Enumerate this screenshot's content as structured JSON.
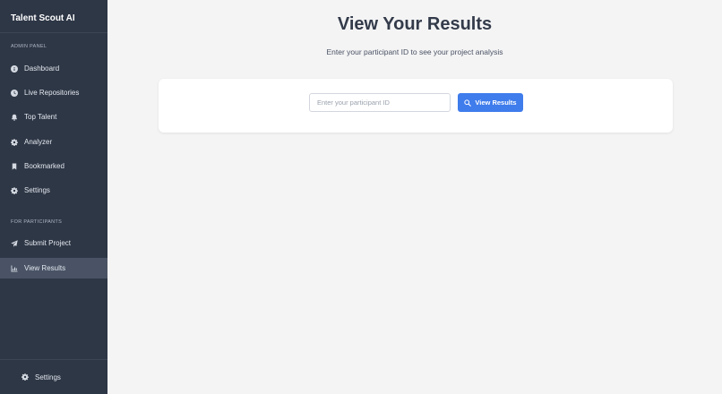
{
  "sidebar": {
    "brand": "Talent Scout AI",
    "admin_label": "ADMIN PANEL",
    "admin_items": [
      {
        "label": "Dashboard",
        "icon": "info-icon"
      },
      {
        "label": "Live Repositories",
        "icon": "clock-icon"
      },
      {
        "label": "Top Talent",
        "icon": "bell-icon"
      },
      {
        "label": "Analyzer",
        "icon": "gear-icon"
      },
      {
        "label": "Bookmarked",
        "icon": "bookmark-icon"
      },
      {
        "label": "Settings",
        "icon": "gear-icon"
      }
    ],
    "participant_label": "FOR PARTICIPANTS",
    "participant_items": [
      {
        "label": "Submit Project",
        "icon": "paper-plane-icon"
      },
      {
        "label": "View Results",
        "icon": "chart-icon",
        "active": true
      }
    ],
    "footer": {
      "label": "Settings",
      "icon": "gear-icon"
    }
  },
  "main": {
    "title": "View Your Results",
    "subtitle": "Enter your participant ID to see your project analysis",
    "input_placeholder": "Enter your participant ID",
    "input_value": "",
    "button_label": "View Results"
  },
  "colors": {
    "sidebar_bg": "#2e3746",
    "active_bg": "#495365",
    "accent": "#3f7cec",
    "page_bg": "#f4f4f5"
  }
}
